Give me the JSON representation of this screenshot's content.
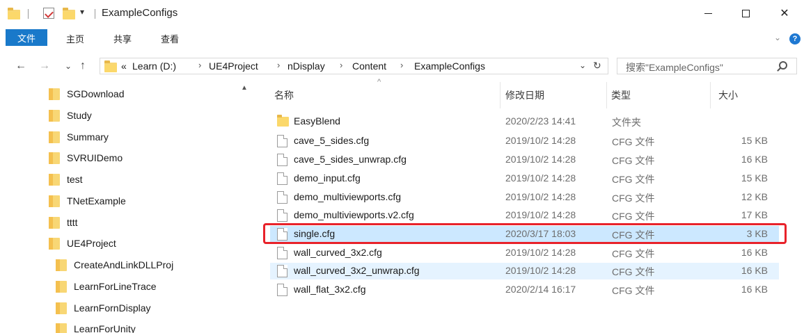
{
  "window": {
    "title": "ExampleConfigs",
    "qa_dropdown": "▾",
    "close_glyph": "✕"
  },
  "ribbon": {
    "tabs": [
      "文件",
      "主页",
      "共享",
      "查看"
    ],
    "expand_glyph": "⌄",
    "help_glyph": "?"
  },
  "nav": {
    "back": "←",
    "forward": "→",
    "recent": "⌄",
    "up": "↑",
    "overflow": "«",
    "breadcrumbs": [
      "Learn (D:)",
      "UE4Project",
      "nDisplay",
      "Content",
      "ExampleConfigs"
    ],
    "sep": "›",
    "dropdown": "⌄",
    "refresh": "↻",
    "search_placeholder": "搜索\"ExampleConfigs\""
  },
  "tree": {
    "scroll_up": "▲",
    "items": [
      "SGDownload",
      "Study",
      "Summary",
      "SVRUIDemo",
      "test",
      "TNetExample",
      "tttt",
      "UE4Project",
      "CreateAndLinkDLLProj",
      "LearnForLineTrace",
      "LearnFornDisplay",
      "LearnForUnity"
    ]
  },
  "files": {
    "headers": {
      "name": "名称",
      "date": "修改日期",
      "type": "类型",
      "size": "大小"
    },
    "sort_caret": "^",
    "rows": [
      {
        "name": "EasyBlend",
        "date": "2020/2/23 14:41",
        "type": "文件夹",
        "size": "",
        "kind": "folder"
      },
      {
        "name": "cave_5_sides.cfg",
        "date": "2019/10/2 14:28",
        "type": "CFG 文件",
        "size": "15 KB",
        "kind": "file"
      },
      {
        "name": "cave_5_sides_unwrap.cfg",
        "date": "2019/10/2 14:28",
        "type": "CFG 文件",
        "size": "16 KB",
        "kind": "file"
      },
      {
        "name": "demo_input.cfg",
        "date": "2019/10/2 14:28",
        "type": "CFG 文件",
        "size": "15 KB",
        "kind": "file"
      },
      {
        "name": "demo_multiviewports.cfg",
        "date": "2019/10/2 14:28",
        "type": "CFG 文件",
        "size": "12 KB",
        "kind": "file"
      },
      {
        "name": "demo_multiviewports.v2.cfg",
        "date": "2019/10/2 14:28",
        "type": "CFG 文件",
        "size": "17 KB",
        "kind": "file"
      },
      {
        "name": "single.cfg",
        "date": "2020/3/17 18:03",
        "type": "CFG 文件",
        "size": "3 KB",
        "kind": "file"
      },
      {
        "name": "wall_curved_3x2.cfg",
        "date": "2019/10/2 14:28",
        "type": "CFG 文件",
        "size": "16 KB",
        "kind": "file"
      },
      {
        "name": "wall_curved_3x2_unwrap.cfg",
        "date": "2019/10/2 14:28",
        "type": "CFG 文件",
        "size": "16 KB",
        "kind": "file"
      },
      {
        "name": "wall_flat_3x2.cfg",
        "date": "2020/2/14 16:17",
        "type": "CFG 文件",
        "size": "16 KB",
        "kind": "file"
      }
    ]
  },
  "colors": {
    "accent": "#1979ca",
    "selection": "#cce8ff",
    "hover": "#e5f3ff",
    "annotation": "#e8222a",
    "folder": "#fbd86b"
  }
}
